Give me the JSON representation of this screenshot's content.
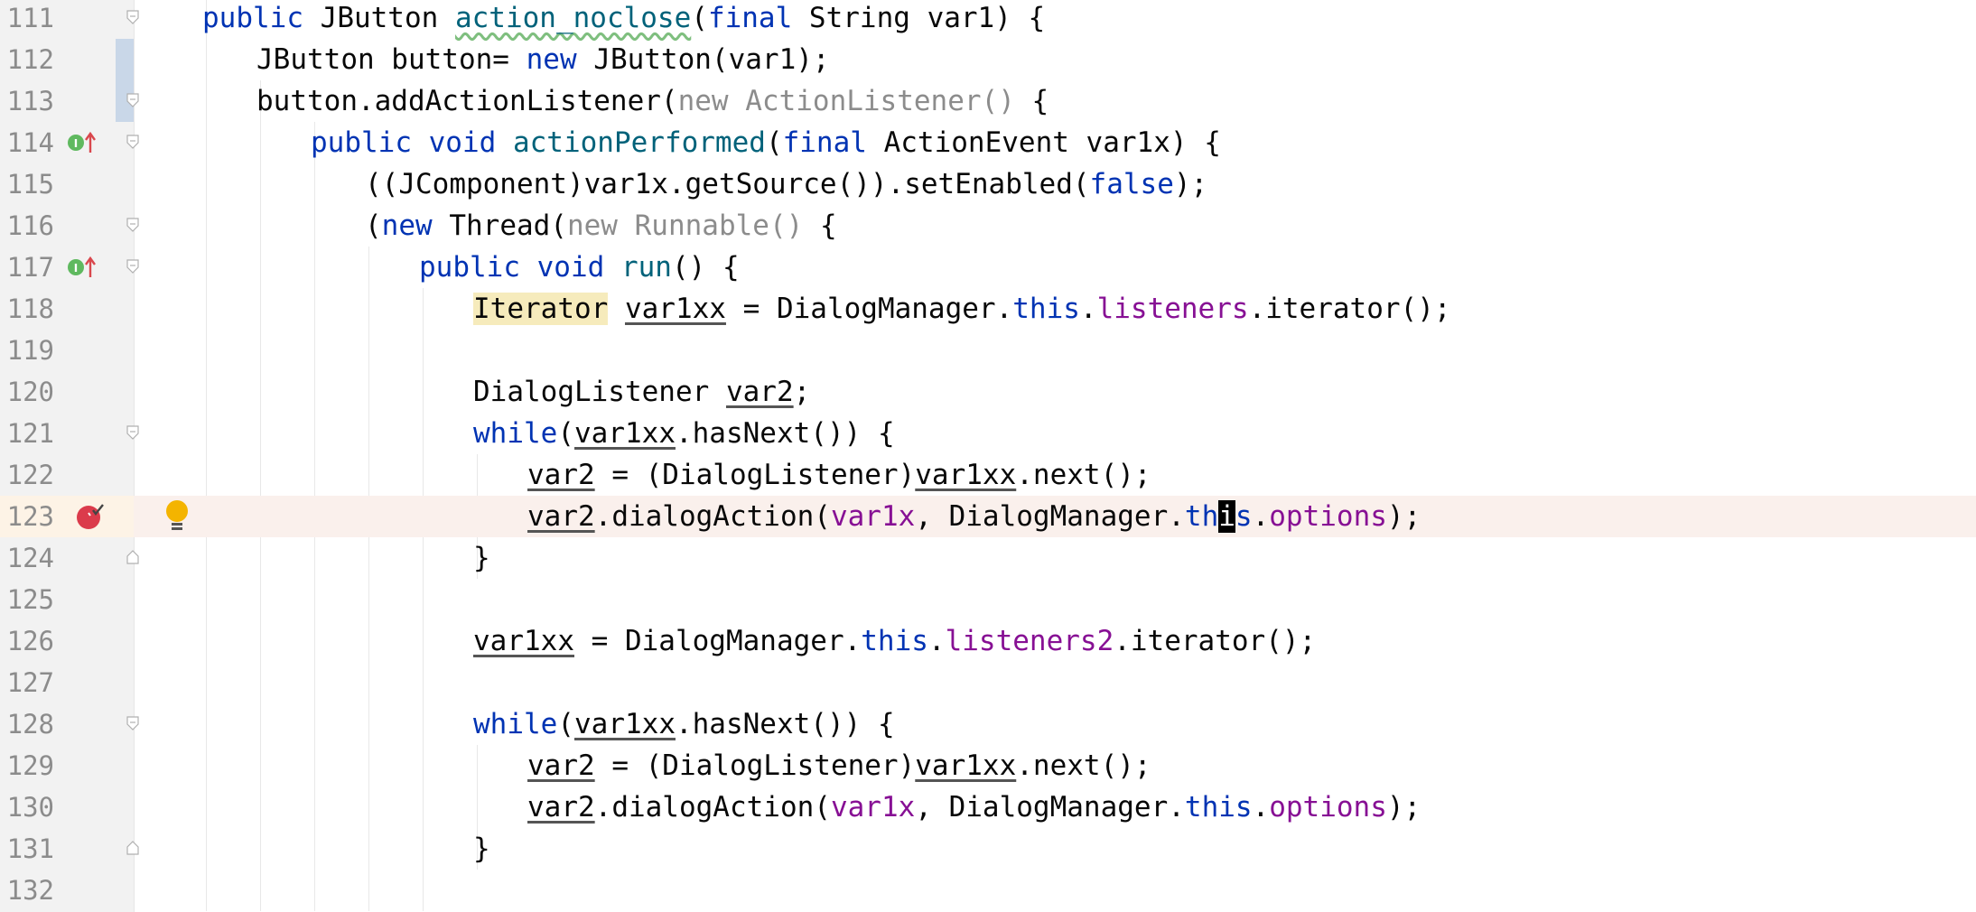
{
  "editor": {
    "lines": [
      {
        "num": "111",
        "indent": 0,
        "tokens": [
          [
            "kw",
            "public "
          ],
          [
            "",
            "JButton "
          ],
          [
            "mth squig",
            "action_noclose"
          ],
          [
            "",
            "("
          ],
          [
            "kw",
            "final "
          ],
          [
            "",
            "String var1) {"
          ]
        ]
      },
      {
        "num": "112",
        "indent": 1,
        "tokens": [
          [
            "",
            "JButton button= "
          ],
          [
            "kw",
            "new "
          ],
          [
            "",
            "JButton(var1);"
          ]
        ]
      },
      {
        "num": "113",
        "indent": 1,
        "tokens": [
          [
            "",
            "button.addActionListener("
          ],
          [
            "grey",
            "new ActionListener() "
          ],
          [
            "",
            "{"
          ]
        ]
      },
      {
        "num": "114",
        "indent": 2,
        "tokens": [
          [
            "kw",
            "public void "
          ],
          [
            "mth",
            "actionPerformed"
          ],
          [
            "",
            "("
          ],
          [
            "kw",
            "final "
          ],
          [
            "",
            "ActionEvent var1x) {"
          ]
        ]
      },
      {
        "num": "115",
        "indent": 3,
        "tokens": [
          [
            "",
            "((JComponent)var1x.getSource()).setEnabled("
          ],
          [
            "kw",
            "false"
          ],
          [
            "",
            ");"
          ]
        ]
      },
      {
        "num": "116",
        "indent": 3,
        "tokens": [
          [
            "",
            "("
          ],
          [
            "kw",
            "new "
          ],
          [
            "",
            "Thread("
          ],
          [
            "grey",
            "new Runnable() "
          ],
          [
            "",
            "{"
          ]
        ]
      },
      {
        "num": "117",
        "indent": 4,
        "tokens": [
          [
            "kw",
            "public void "
          ],
          [
            "mth",
            "run"
          ],
          [
            "",
            "() {"
          ]
        ]
      },
      {
        "num": "118",
        "indent": 5,
        "tokens": [
          [
            "hl",
            "Iterator"
          ],
          [
            "",
            " "
          ],
          [
            "ul",
            "var1xx"
          ],
          [
            "",
            " = DialogManager."
          ],
          [
            "kw",
            "this"
          ],
          [
            "",
            "."
          ],
          [
            "fld",
            "listeners"
          ],
          [
            "",
            ".iterator();"
          ]
        ]
      },
      {
        "num": "119",
        "indent": 5,
        "tokens": []
      },
      {
        "num": "120",
        "indent": 5,
        "tokens": [
          [
            "",
            "DialogListener "
          ],
          [
            "ul",
            "var2"
          ],
          [
            "",
            ";"
          ]
        ]
      },
      {
        "num": "121",
        "indent": 5,
        "tokens": [
          [
            "kw",
            "while"
          ],
          [
            "",
            "("
          ],
          [
            "ul",
            "var1xx"
          ],
          [
            "",
            ".hasNext()) {"
          ]
        ]
      },
      {
        "num": "122",
        "indent": 6,
        "tokens": [
          [
            "ul",
            "var2"
          ],
          [
            "",
            " = (DialogListener)"
          ],
          [
            "ul",
            "var1xx"
          ],
          [
            "",
            ".next();"
          ]
        ]
      },
      {
        "num": "123",
        "indent": 6,
        "tokens": [
          [
            "ul",
            "var2"
          ],
          [
            "",
            ".dialogAction("
          ],
          [
            "param",
            "var1x"
          ],
          [
            "",
            ", DialogManager."
          ],
          [
            "kw",
            "th"
          ],
          [
            "caret",
            "i"
          ],
          [
            "kw",
            "s"
          ],
          [
            "",
            "."
          ],
          [
            "fld",
            "options"
          ],
          [
            "",
            ");"
          ]
        ]
      },
      {
        "num": "124",
        "indent": 5,
        "tokens": [
          [
            "",
            "}"
          ]
        ]
      },
      {
        "num": "125",
        "indent": 5,
        "tokens": []
      },
      {
        "num": "126",
        "indent": 5,
        "tokens": [
          [
            "ul",
            "var1xx"
          ],
          [
            "",
            " = DialogManager."
          ],
          [
            "kw",
            "this"
          ],
          [
            "",
            "."
          ],
          [
            "fld",
            "listeners2"
          ],
          [
            "",
            ".iterator();"
          ]
        ]
      },
      {
        "num": "127",
        "indent": 5,
        "tokens": []
      },
      {
        "num": "128",
        "indent": 5,
        "tokens": [
          [
            "kw",
            "while"
          ],
          [
            "",
            "("
          ],
          [
            "ul",
            "var1xx"
          ],
          [
            "",
            ".hasNext()) {"
          ]
        ]
      },
      {
        "num": "129",
        "indent": 6,
        "tokens": [
          [
            "ul",
            "var2"
          ],
          [
            "",
            " = (DialogListener)"
          ],
          [
            "ul",
            "var1xx"
          ],
          [
            "",
            ".next();"
          ]
        ]
      },
      {
        "num": "130",
        "indent": 6,
        "tokens": [
          [
            "ul",
            "var2"
          ],
          [
            "",
            ".dialogAction("
          ],
          [
            "param",
            "var1x"
          ],
          [
            "",
            ", DialogManager."
          ],
          [
            "kw",
            "this"
          ],
          [
            "",
            "."
          ],
          [
            "fld",
            "options"
          ],
          [
            "",
            ");"
          ]
        ]
      },
      {
        "num": "131",
        "indent": 5,
        "tokens": [
          [
            "",
            "}"
          ]
        ]
      },
      {
        "num": "132",
        "indent": 5,
        "tokens": []
      }
    ],
    "fold_open_lines": [
      "111",
      "113",
      "114",
      "116",
      "117",
      "121",
      "128"
    ],
    "fold_close_lines": [
      "124",
      "131"
    ],
    "implements_icon_lines": [
      "114",
      "117"
    ],
    "breakpoint_line": "123",
    "intention_bulb_line": "123",
    "current_line": "123",
    "vcs_changed_lines": [
      "112",
      "113"
    ],
    "colors": {
      "keyword": "#0033b3",
      "method": "#00627a",
      "field": "#871094",
      "comment_grey": "#8c8c8c",
      "breakpoint": "#db3b4b",
      "bulb": "#f4b400",
      "current_line_bg": "#faf0ec"
    }
  }
}
